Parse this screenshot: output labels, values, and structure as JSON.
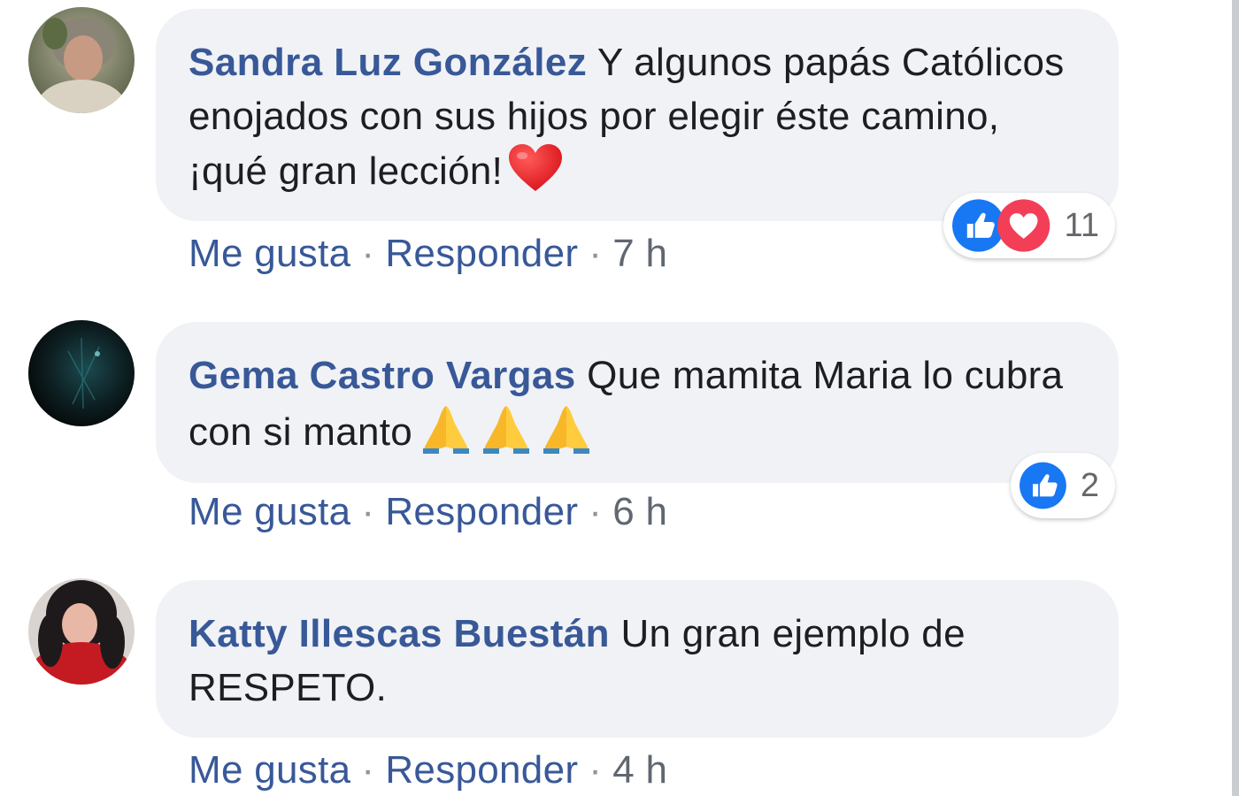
{
  "comments": [
    {
      "author": "Sandra Luz González",
      "text": "Y algunos papás Católicos enojados con sus hijos por elegir éste camino, ¡qué gran lección!",
      "emoji": "red-heart",
      "reactions": {
        "icons": [
          "like-icon",
          "love-icon"
        ],
        "count": "11"
      },
      "actions": {
        "like": "Me gusta",
        "reply": "Responder",
        "time": "7 h"
      }
    },
    {
      "author": "Gema Castro Vargas",
      "text": "Que mamita Maria lo cubra con si manto",
      "emoji": "folded-hands",
      "emoji_count": 3,
      "reactions": {
        "icons": [
          "like-icon"
        ],
        "count": "2"
      },
      "actions": {
        "like": "Me gusta",
        "reply": "Responder",
        "time": "6 h"
      }
    },
    {
      "author": "Katty Illescas Buestán",
      "text": "Un gran ejemplo de RESPETO.",
      "actions": {
        "like": "Me gusta",
        "reply": "Responder",
        "time": "4 h"
      }
    }
  ],
  "colors": {
    "author": "#385898",
    "bubble": "#f0f2f5",
    "like_blue": "#1877f2",
    "love_red": "#f33e58"
  }
}
